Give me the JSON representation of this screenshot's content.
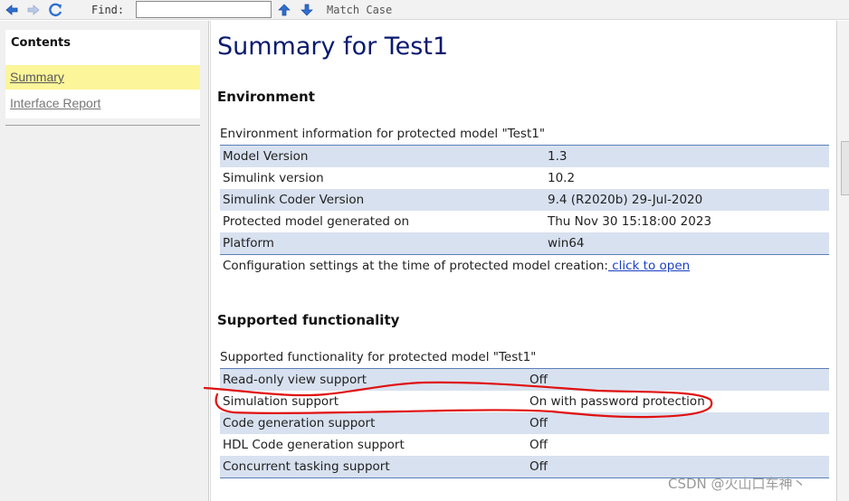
{
  "toolbar": {
    "back_icon": "arrow-left-icon",
    "forward_icon": "arrow-right-icon",
    "refresh_icon": "refresh-icon",
    "find_label": "Find:",
    "find_value": "",
    "find_next_icon": "arrow-up-icon",
    "find_prev_icon": "arrow-down-icon",
    "match_case_label": "Match Case"
  },
  "sidebar": {
    "title": "Contents",
    "items": [
      {
        "label": "Summary",
        "active": true
      },
      {
        "label": "Interface Report",
        "active": false
      }
    ]
  },
  "main": {
    "title": "Summary for Test1",
    "environment": {
      "heading": "Environment",
      "caption": "Environment information for protected model \"Test1\"",
      "rows": [
        {
          "key": "Model Version",
          "value": "1.3"
        },
        {
          "key": "Simulink version",
          "value": "10.2"
        },
        {
          "key": "Simulink Coder Version",
          "value": "9.4 (R2020b) 29-Jul-2020"
        },
        {
          "key": "Protected model generated on",
          "value": "Thu Nov 30 15:18:00 2023"
        },
        {
          "key": "Platform",
          "value": "win64"
        }
      ],
      "config_text": "Configuration settings at the time of protected model creation:",
      "config_link": " click to open"
    },
    "functionality": {
      "heading": "Supported functionality",
      "caption": "Supported functionality for protected model \"Test1\"",
      "rows": [
        {
          "key": "Read-only view support",
          "value": "Off"
        },
        {
          "key": "Simulation support",
          "value": "On with password protection"
        },
        {
          "key": "Code generation support",
          "value": "Off"
        },
        {
          "key": "HDL Code generation support",
          "value": "Off"
        },
        {
          "key": "Concurrent tasking support",
          "value": "Off"
        }
      ]
    }
  },
  "colors": {
    "title": "#0a1a6e",
    "row_shade": "#d8e1ef",
    "rule": "#5a7fb8",
    "active_nav": "#fcf59a",
    "annotation": "#e01010"
  },
  "watermark": "CSDN @火山口车神丶"
}
